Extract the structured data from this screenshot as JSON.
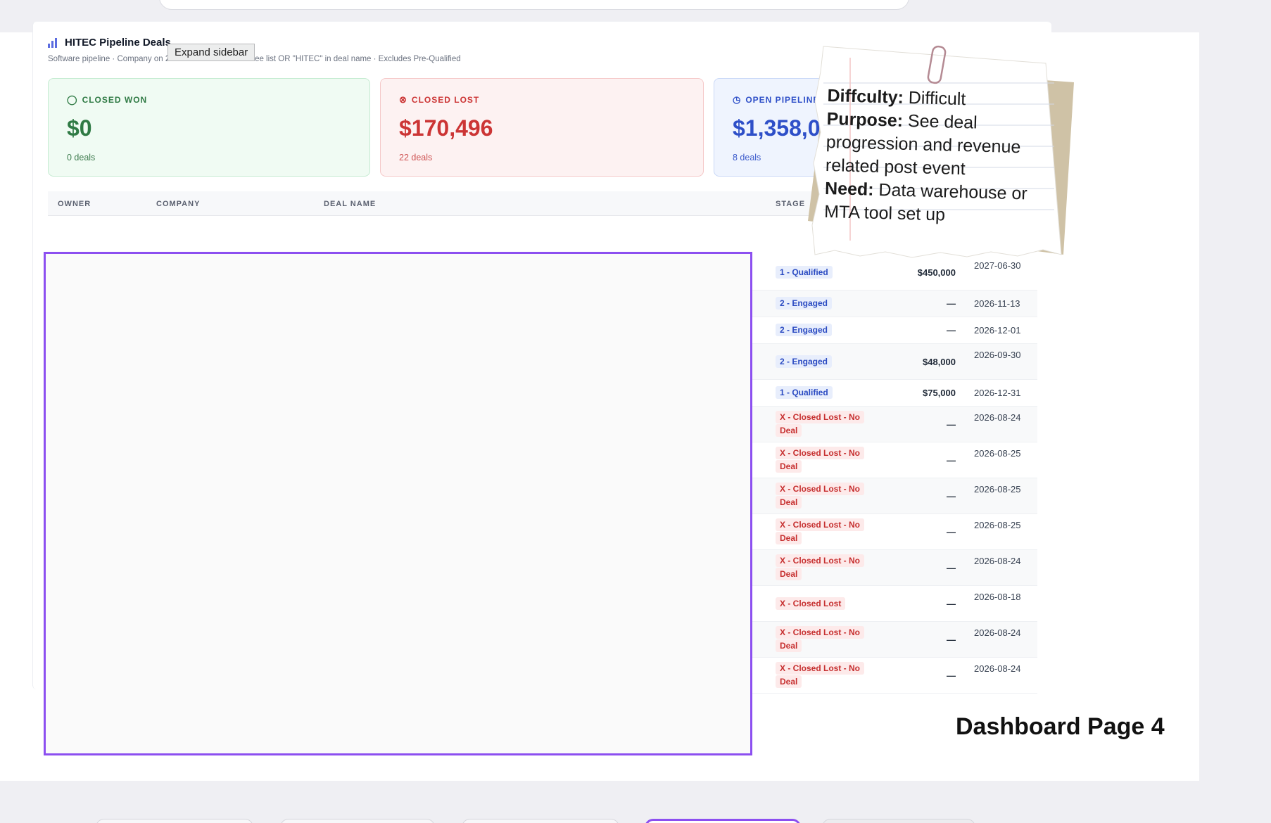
{
  "dashboard": {
    "title": "HITEC Pipeline Deals",
    "subtitle": "Software pipeline · Company on 2025/2026 HITEC attendee list OR \"HITEC\" in deal name · Excludes Pre-Qualified"
  },
  "tooltip": {
    "text": "Expand sidebar"
  },
  "kpis": {
    "won": {
      "label": "CLOSED WON",
      "value": "$0",
      "count": "0 deals"
    },
    "lost": {
      "label": "CLOSED LOST",
      "value": "$170,496",
      "count": "22 deals"
    },
    "open": {
      "label": "OPEN PIPELINE",
      "value": "$1,358,000",
      "count": "8 deals"
    }
  },
  "table": {
    "columns": {
      "owner": "OWNER",
      "company": "COMPANY",
      "deal_name": "DEAL NAME",
      "stage": "STAGE"
    },
    "rows": [
      {
        "stage": "1 - Qualified",
        "stage_color": "blue",
        "amount": "$450,000",
        "date": "2027-06-30"
      },
      {
        "stage": "2 - Engaged",
        "stage_color": "blue",
        "amount": "—",
        "date": "2026-11-13"
      },
      {
        "stage": "2 - Engaged",
        "stage_color": "blue",
        "amount": "—",
        "date": "2026-12-01"
      },
      {
        "stage": "2 - Engaged",
        "stage_color": "blue",
        "amount": "$48,000",
        "date": "2026-09-30"
      },
      {
        "stage": "1 - Qualified",
        "stage_color": "blue",
        "amount": "$75,000",
        "date": "2026-12-31"
      },
      {
        "stage": "X - Closed Lost - No Deal",
        "stage_color": "red",
        "amount": "—",
        "date": "2026-08-24"
      },
      {
        "stage": "X - Closed Lost - No Deal",
        "stage_color": "red",
        "amount": "—",
        "date": "2026-08-25"
      },
      {
        "stage": "X - Closed Lost - No Deal",
        "stage_color": "red",
        "amount": "—",
        "date": "2026-08-25"
      },
      {
        "stage": "X - Closed Lost - No Deal",
        "stage_color": "red",
        "amount": "—",
        "date": "2026-08-25"
      },
      {
        "stage": "X - Closed Lost - No Deal",
        "stage_color": "red",
        "amount": "—",
        "date": "2026-08-24"
      },
      {
        "stage": "X - Closed Lost",
        "stage_color": "red",
        "amount": "—",
        "date": "2026-08-18"
      },
      {
        "stage": "X - Closed Lost - No Deal",
        "stage_color": "red",
        "amount": "—",
        "date": "2026-08-24"
      },
      {
        "stage": "X - Closed Lost - No Deal",
        "stage_color": "red",
        "amount": "—",
        "date": "2026-08-24"
      }
    ]
  },
  "note": {
    "difficulty_label": "Diffculty:",
    "difficulty_value": "Difficult",
    "purpose_label": "Purpose:",
    "purpose_value": "See deal progression and revenue related post event",
    "need_label": "Need:",
    "need_value": "Data warehouse or MTA tool set up"
  },
  "page_label": "Dashboard Page 4",
  "colors": {
    "won": "#2f7a44",
    "lost": "#cc3535",
    "open": "#2e4fc8",
    "redaction_border": "#8c4ff0"
  },
  "icons": {
    "title": "bar-chart-icon",
    "won": "check-circle-icon",
    "lost": "x-circle-icon",
    "open": "clock-icon",
    "paperclip": "paperclip-icon"
  }
}
